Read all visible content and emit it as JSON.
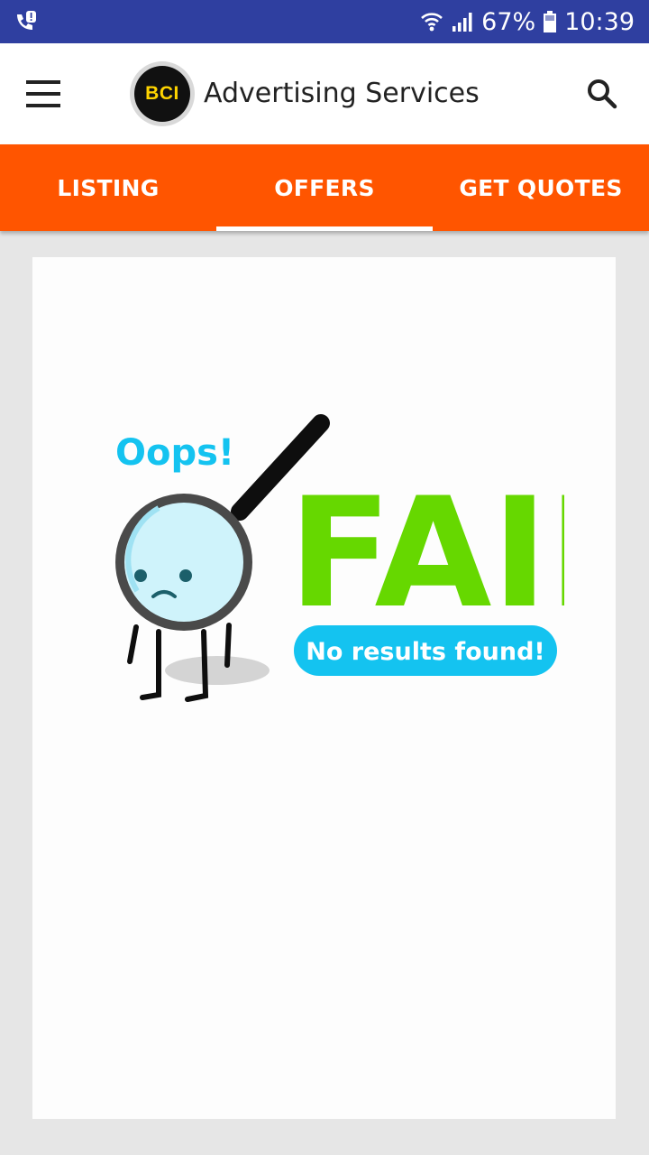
{
  "status_bar": {
    "battery": "67%",
    "time": "10:39",
    "bg_color": "#2f3fa0",
    "icons": [
      "call-alert-icon",
      "wifi-icon",
      "signal-icon",
      "battery-icon"
    ]
  },
  "app_bar": {
    "logo_text": "BCI",
    "title": "Advertising Services",
    "icons": [
      "menu-icon",
      "search-icon"
    ]
  },
  "tabs": {
    "accent_color": "#ff5500",
    "items": [
      {
        "label": "LISTING",
        "active": false
      },
      {
        "label": "OFFERS",
        "active": true
      },
      {
        "label": "GET QUOTES",
        "active": false
      }
    ]
  },
  "empty_state": {
    "oops": "Oops!",
    "fail": "FAIL",
    "message": "No results found!",
    "colors": {
      "oops": "#14c3f0",
      "fail": "#66d800",
      "pill": "#14c3f0"
    }
  }
}
